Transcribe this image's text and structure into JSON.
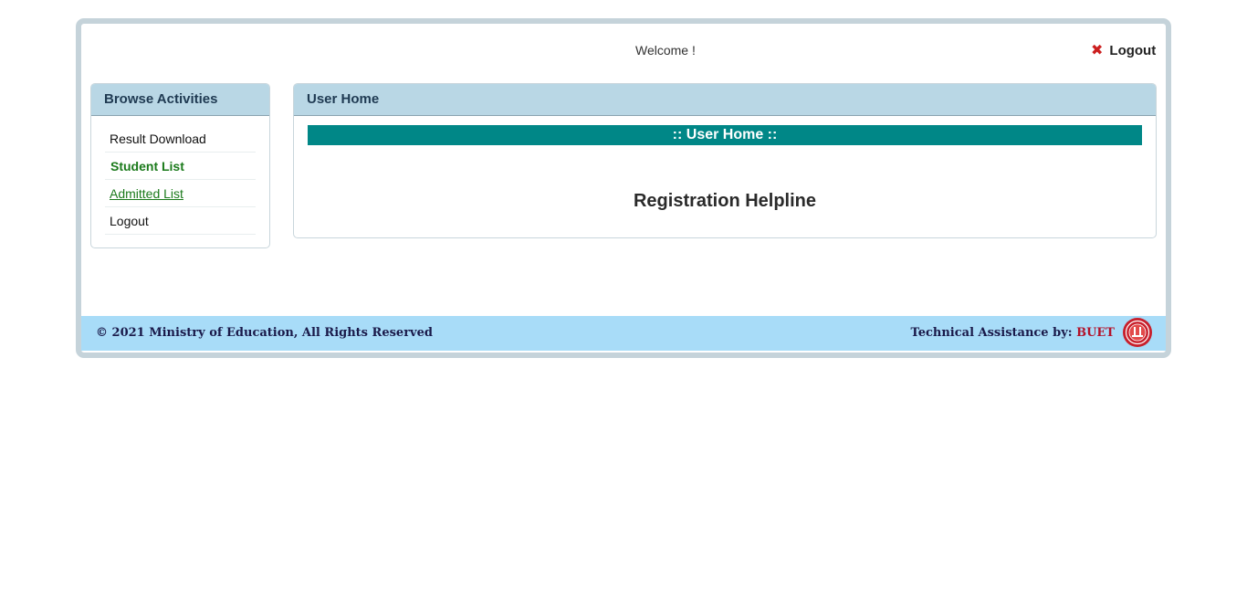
{
  "header": {
    "welcome_text": "Welcome !",
    "logout_label": "Logout",
    "logout_icon": "close-x-icon"
  },
  "sidebar": {
    "title": "Browse Activities",
    "items": [
      {
        "label": "Result Download",
        "state": "normal"
      },
      {
        "label": "Student List",
        "state": "active"
      },
      {
        "label": "Admitted List",
        "state": "link"
      },
      {
        "label": "Logout",
        "state": "normal"
      }
    ]
  },
  "main": {
    "title": "User Home",
    "banner": ":: User Home ::",
    "helpline_heading": "Registration Helpline"
  },
  "footer": {
    "copyright": "© 2021 Ministry of Education, All Rights Reserved",
    "tech_label": "Technical Assistance by:",
    "tech_org": "BUET",
    "seal_icon": "buet-seal-icon"
  },
  "colors": {
    "header_panel": "#b9d7e5",
    "banner_teal": "#008787",
    "footer_bg": "#a8dcf8",
    "active_link": "#1b7a1b",
    "logout_icon": "#cc1f1f",
    "buet_red": "#b3122a"
  }
}
